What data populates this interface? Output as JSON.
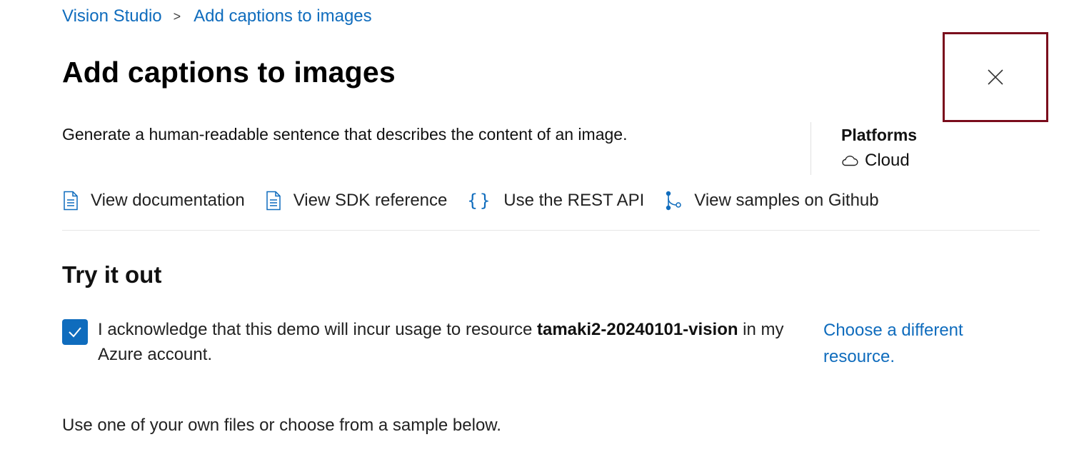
{
  "breadcrumb": {
    "root": "Vision Studio",
    "separator": ">",
    "current": "Add captions to images"
  },
  "title": "Add captions to images",
  "description": "Generate a human-readable sentence that describes the content of an image.",
  "close": {
    "icon": "close-icon",
    "highlight_color": "#7a0c1c"
  },
  "platforms": {
    "heading": "Platforms",
    "item": {
      "icon": "cloud-icon",
      "label": "Cloud"
    }
  },
  "links": [
    {
      "icon": "document-icon",
      "label": "View documentation"
    },
    {
      "icon": "document-icon",
      "label": "View SDK reference"
    },
    {
      "icon": "braces-icon",
      "glyph": "{}",
      "label": "Use the REST API"
    },
    {
      "icon": "branch-icon",
      "label": "View samples on Github"
    }
  ],
  "try_it_out": {
    "title": "Try it out",
    "acknowledge": {
      "checked": true,
      "text_before": "I acknowledge that this demo will incur usage to resource ",
      "resource": "tamaki2-20240101-vision",
      "text_after": " in my Azure account."
    },
    "choose_link": "Choose a different resource.",
    "instruction": "Use one of your own files or choose from a sample below."
  },
  "colors": {
    "accent": "#0f6cbd",
    "close_border": "#7a0c1c",
    "text": "#1b1b1b"
  }
}
